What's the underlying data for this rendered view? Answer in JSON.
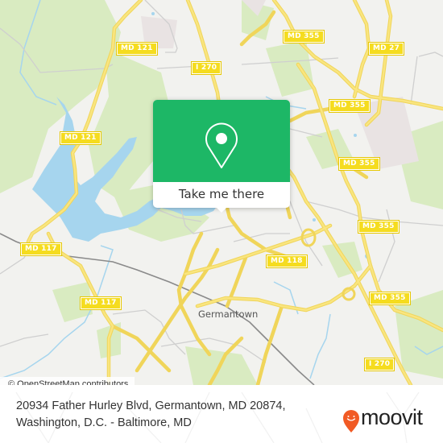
{
  "map": {
    "attribution": "© OpenStreetMap contributors",
    "place_labels": [
      {
        "name": "germantown",
        "text": "Germantown"
      }
    ],
    "route_shields": [
      {
        "id": "md121-top",
        "text": "MD 121"
      },
      {
        "id": "i270-top",
        "text": "I 270"
      },
      {
        "id": "md355-top",
        "text": "MD 355"
      },
      {
        "id": "md27",
        "text": "MD 27"
      },
      {
        "id": "md121-mid",
        "text": "MD 121"
      },
      {
        "id": "md355-2",
        "text": "MD 355"
      },
      {
        "id": "md355-3",
        "text": "MD 355"
      },
      {
        "id": "md355-4",
        "text": "MD 355"
      },
      {
        "id": "md117-left",
        "text": "MD 117"
      },
      {
        "id": "md118",
        "text": "MD 118"
      },
      {
        "id": "md117-low",
        "text": "MD 117"
      },
      {
        "id": "md355-5",
        "text": "MD 355"
      },
      {
        "id": "i270-bottom",
        "text": "I 270"
      }
    ],
    "colors": {
      "land": "#f2f2ef",
      "park": "#d9ebc1",
      "water": "#a6d5ee",
      "road_major": "#f7de63",
      "road_minor": "#c9c9c9",
      "shield": "#f5dc1f"
    }
  },
  "popup": {
    "icon": "map-pin-icon",
    "button_label": "Take me there",
    "accent_color": "#1db766"
  },
  "footer": {
    "address": "20934 Father Hurley Blvd, Germantown, MD 20874, Washington, D.C. - Baltimore, MD",
    "brand": "moovit",
    "brand_color": "#f15a24"
  }
}
